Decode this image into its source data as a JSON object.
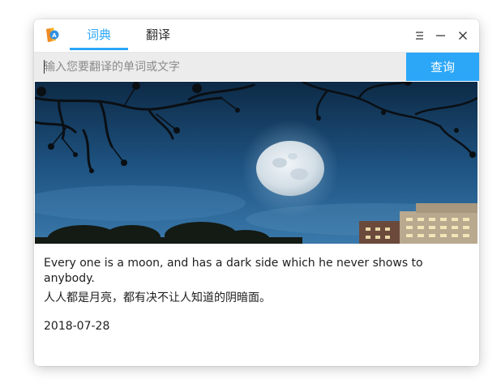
{
  "tabs": [
    {
      "label": "词典",
      "active": true
    },
    {
      "label": "翻译",
      "active": false
    }
  ],
  "window_controls": {
    "menu_icon": "hamburger-icon",
    "minimize_icon": "minimize-icon",
    "close_icon": "close-icon"
  },
  "search": {
    "placeholder": "输入您要翻译的单词或文字",
    "value": "",
    "button_label": "查询"
  },
  "daily": {
    "image_subject": "full moon over night sky",
    "sentence_en": "Every one is a moon, and has a dark side which he never shows to anybody.",
    "sentence_zh": "人人都是月亮，都有决不让人知道的阴暗面。",
    "date": "2018-07-28"
  },
  "colors": {
    "accent": "#2ca7f8",
    "search_bg": "#ececec",
    "sky_top": "#0f2e4c",
    "sky_bottom": "#2f6fa3"
  }
}
